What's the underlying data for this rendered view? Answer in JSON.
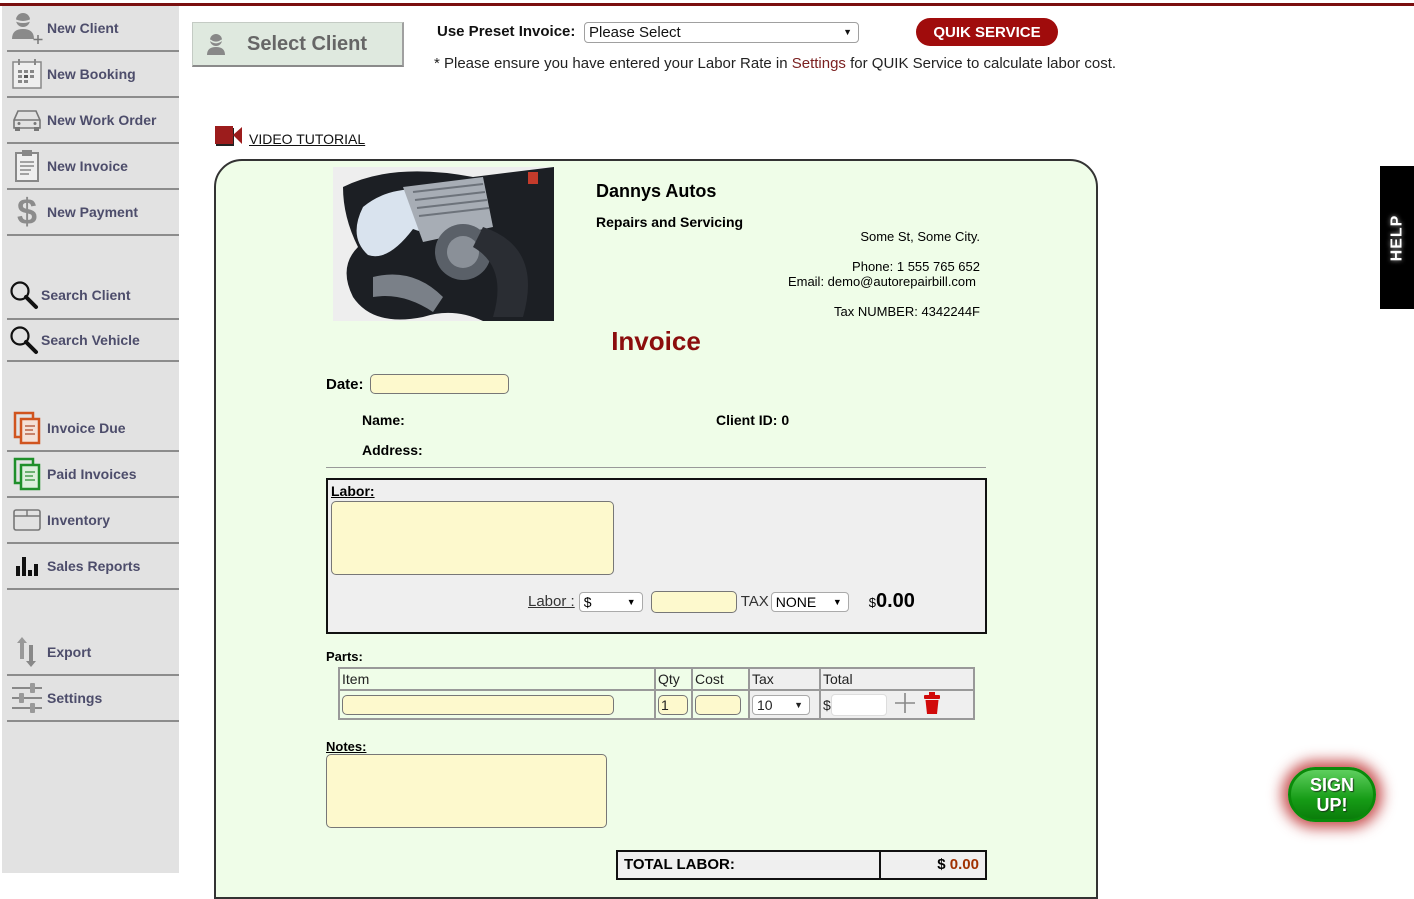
{
  "sidebar": {
    "items": [
      {
        "label": "New Client",
        "icon": "add-user-icon"
      },
      {
        "label": "New Booking",
        "icon": "calendar-icon"
      },
      {
        "label": "New Work Order",
        "icon": "car-icon"
      },
      {
        "label": "New Invoice",
        "icon": "clipboard-icon"
      },
      {
        "label": "New Payment",
        "icon": "dollar-icon"
      },
      {
        "label": "Search Client",
        "icon": "search-icon"
      },
      {
        "label": "Search Vehicle",
        "icon": "search-icon"
      },
      {
        "label": "Invoice Due",
        "icon": "invoice-due-icon"
      },
      {
        "label": "Paid Invoices",
        "icon": "paid-invoices-icon"
      },
      {
        "label": "Inventory",
        "icon": "box-icon"
      },
      {
        "label": "Sales Reports",
        "icon": "bar-chart-icon"
      },
      {
        "label": "Export",
        "icon": "export-arrows-icon"
      },
      {
        "label": "Settings",
        "icon": "sliders-icon"
      }
    ]
  },
  "header": {
    "select_client_label": "Select Client",
    "preset_label": "Use Preset Invoice:",
    "preset_value": "Please Select",
    "quik_service_label": "QUIK SERVICE",
    "notice_pre": "* Please ensure you have entered your Labor Rate in ",
    "notice_link": "Settings",
    "notice_post": " for QUIK Service to calculate labor cost.",
    "video_tutorial": "VIDEO TUTORIAL"
  },
  "business": {
    "name": "Dannys Autos",
    "tagline": "Repairs and Servicing",
    "address": "Some St, Some City.",
    "phone": "Phone: 1 555 765 652",
    "email": "Email: demo@autorepairbill.com",
    "tax_number": "Tax NUMBER: 4342244F"
  },
  "invoice": {
    "title": "Invoice",
    "date_label": "Date:",
    "date_value": "",
    "name_label": "Name:",
    "client_id_label": "Client ID: 0",
    "address_label": "Address:",
    "labor": {
      "title": "Labor:",
      "description": "",
      "rate_label": "Labor :",
      "rate_unit": "$",
      "amount": "",
      "tax_label": "TAX",
      "tax_value": "NONE",
      "currency": "$",
      "total": "0.00"
    },
    "parts": {
      "label": "Parts:",
      "columns": [
        "Item",
        "Qty",
        "Cost",
        "Tax",
        "Total"
      ],
      "rows": [
        {
          "item": "",
          "qty": "1",
          "cost": "",
          "tax": "10",
          "currency": "$",
          "total": ""
        }
      ]
    },
    "notes_label": "Notes:",
    "notes_value": "",
    "totals": {
      "total_labor_label": "TOTAL LABOR:",
      "total_labor_currency": "$",
      "total_labor_value": "0.00"
    }
  },
  "help_tab": "HELP",
  "signup": {
    "line1": "SIGN",
    "line2": "UP!"
  },
  "colors": {
    "brand": "#7a0f0f",
    "quik_button": "#a00c0c",
    "panel_bg": "#effde8",
    "input_bg": "#fdf9cd",
    "signup_green": "#169c16"
  }
}
